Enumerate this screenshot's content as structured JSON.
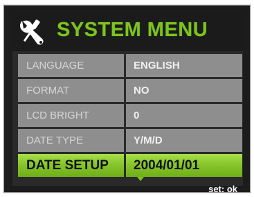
{
  "header": {
    "title": "SYSTEM MENU",
    "icon": "wrench-screwdriver-icon",
    "title_color": "#7cc31e"
  },
  "menu": {
    "items": [
      {
        "label": "LANGUAGE",
        "value": "ENGLISH",
        "selected": false
      },
      {
        "label": "FORMAT",
        "value": "NO",
        "selected": false
      },
      {
        "label": "LCD BRIGHT",
        "value": "0",
        "selected": false
      },
      {
        "label": "DATE TYPE",
        "value": "Y/M/D",
        "selected": false
      },
      {
        "label": "DATE SETUP",
        "value": "2004/01/01",
        "selected": true
      }
    ],
    "scroll_indicator": "down-arrow-icon",
    "highlight_color": "#8cc82e",
    "row_color": "#8e8e8e"
  },
  "footer": {
    "hint": "set: ok"
  }
}
